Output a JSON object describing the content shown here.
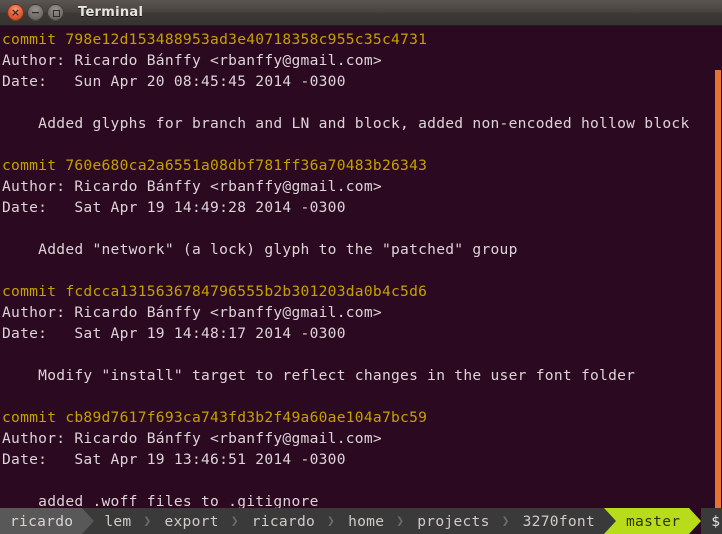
{
  "window": {
    "title": "Terminal",
    "buttons": [
      {
        "name": "close",
        "glyph": "×"
      },
      {
        "name": "minimize",
        "glyph": "−"
      },
      {
        "name": "maximize",
        "glyph": "□"
      }
    ]
  },
  "colors": {
    "terminal_bg": "#2b0a21",
    "titlebar_bg": "#474340",
    "commit_text": "#c4a000",
    "body_text": "#ddd4d8",
    "scrollbar": "#e8722e",
    "segment_light": "#585858",
    "segment_dark": "#3a3a3a",
    "segment_branch": "#b8dc1a",
    "cursor": "#ffffff"
  },
  "terminal": {
    "lines": [
      {
        "text": "commit 798e12d153488953ad3e40718358c955c35c4731",
        "color": "commit"
      },
      {
        "text": "Author: Ricardo Bánffy <rbanffy@gmail.com>",
        "color": "plain"
      },
      {
        "text": "Date:   Sun Apr 20 08:45:45 2014 -0300",
        "color": "plain"
      },
      {
        "text": "",
        "color": "plain"
      },
      {
        "text": "    Added glyphs for branch and LN and block, added non-encoded hollow block",
        "color": "plain"
      },
      {
        "text": "",
        "color": "plain"
      },
      {
        "text": "commit 760e680ca2a6551a08dbf781ff36a70483b26343",
        "color": "commit"
      },
      {
        "text": "Author: Ricardo Bánffy <rbanffy@gmail.com>",
        "color": "plain"
      },
      {
        "text": "Date:   Sat Apr 19 14:49:28 2014 -0300",
        "color": "plain"
      },
      {
        "text": "",
        "color": "plain"
      },
      {
        "text": "    Added \"network\" (a lock) glyph to the \"patched\" group",
        "color": "plain"
      },
      {
        "text": "",
        "color": "plain"
      },
      {
        "text": "commit fcdcca1315636784796555b2b301203da0b4c5d6",
        "color": "commit"
      },
      {
        "text": "Author: Ricardo Bánffy <rbanffy@gmail.com>",
        "color": "plain"
      },
      {
        "text": "Date:   Sat Apr 19 14:48:17 2014 -0300",
        "color": "plain"
      },
      {
        "text": "",
        "color": "plain"
      },
      {
        "text": "    Modify \"install\" target to reflect changes in the user font folder",
        "color": "plain"
      },
      {
        "text": "",
        "color": "plain"
      },
      {
        "text": "commit cb89d7617f693ca743fd3b2f49a60ae104a7bc59",
        "color": "commit"
      },
      {
        "text": "Author: Ricardo Bánffy <rbanffy@gmail.com>",
        "color": "plain"
      },
      {
        "text": "Date:   Sat Apr 19 13:46:51 2014 -0300",
        "color": "plain"
      },
      {
        "text": "",
        "color": "plain"
      },
      {
        "text": "    added .woff files to .gitignore",
        "color": "plain"
      }
    ]
  },
  "statusbar": {
    "segments": [
      {
        "label": "ricardo",
        "style": "light"
      },
      {
        "label": "lem",
        "style": "dark"
      },
      {
        "label": "export",
        "style": "dark"
      },
      {
        "label": "ricardo",
        "style": "dark"
      },
      {
        "label": "home",
        "style": "dark"
      },
      {
        "label": "projects",
        "style": "dark"
      },
      {
        "label": "3270font",
        "style": "dark"
      },
      {
        "label": "master",
        "style": "branch"
      },
      {
        "label": "$",
        "style": "prompt"
      }
    ],
    "thin_separator": "❯"
  },
  "scrollbar": {
    "position_label": ""
  }
}
